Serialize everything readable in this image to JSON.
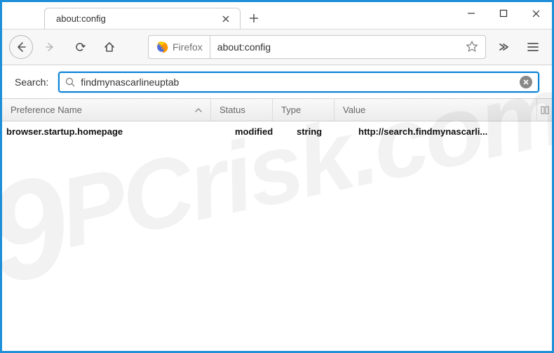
{
  "window": {
    "tab_title": "about:config"
  },
  "navbar": {
    "identity_label": "Firefox",
    "url": "about:config"
  },
  "search": {
    "label": "Search:",
    "value": "findmynascarlineuptab"
  },
  "columns": {
    "name": "Preference Name",
    "status": "Status",
    "type": "Type",
    "value": "Value"
  },
  "rows": [
    {
      "name": "browser.startup.homepage",
      "status": "modified",
      "type": "string",
      "value": "http://search.findmynascarli..."
    }
  ],
  "watermark": "PCrisk.com"
}
